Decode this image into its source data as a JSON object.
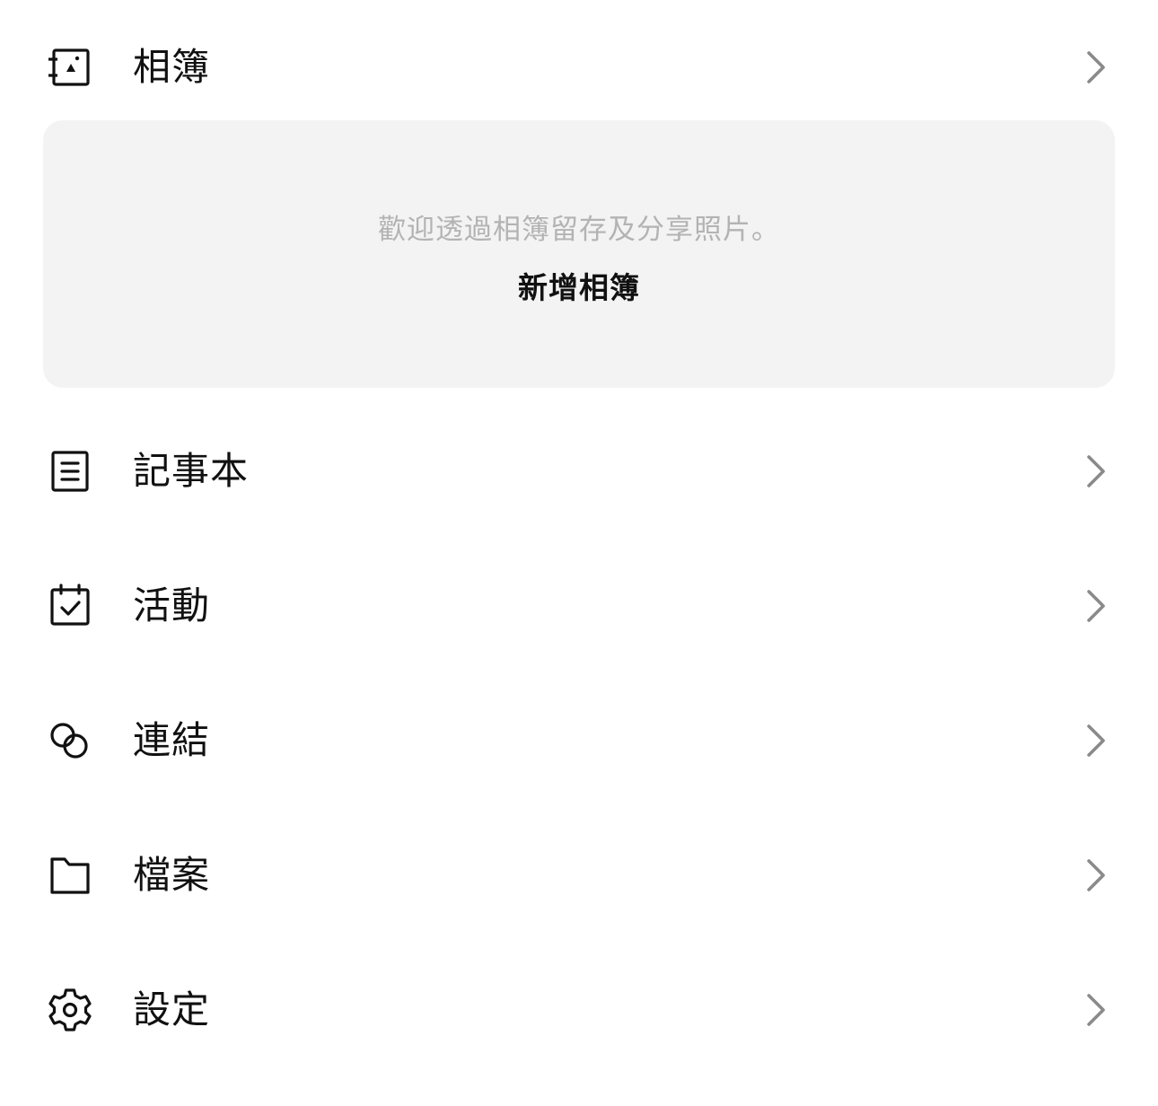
{
  "albums": {
    "label": "相簿",
    "icon": "album-icon",
    "empty_hint": "歡迎透過相簿留存及分享照片。",
    "create_label": "新增相簿"
  },
  "menu": [
    {
      "label": "記事本",
      "icon": "note-icon"
    },
    {
      "label": "活動",
      "icon": "calendar-check-icon"
    },
    {
      "label": "連結",
      "icon": "link-icon"
    },
    {
      "label": "檔案",
      "icon": "folder-icon"
    },
    {
      "label": "設定",
      "icon": "gear-icon"
    }
  ],
  "colors": {
    "text": "#111111",
    "hint": "#b3b3b3",
    "card_bg": "#f3f3f3",
    "chevron": "#8a8a8a"
  }
}
